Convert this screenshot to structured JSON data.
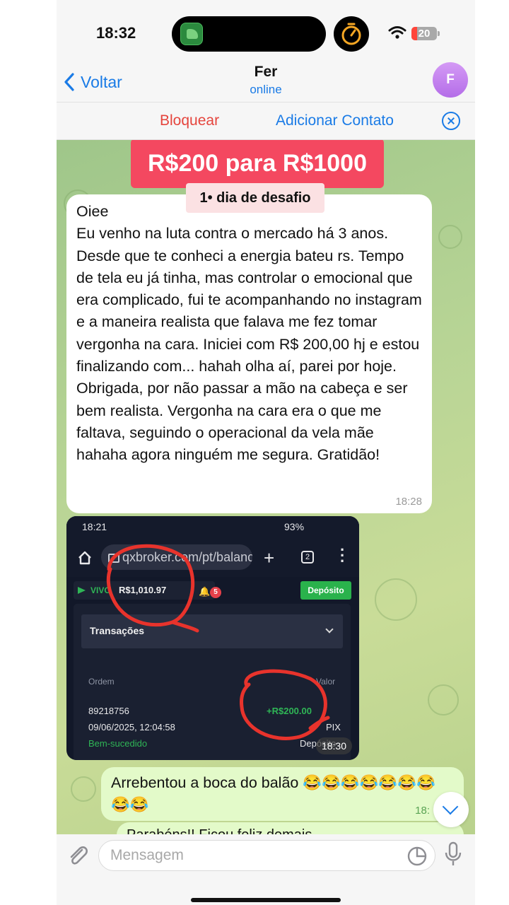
{
  "status_bar": {
    "time": "18:32",
    "battery": "20"
  },
  "header": {
    "back_label": "Voltar",
    "contact_name": "Fer",
    "contact_status": "online",
    "avatar_letter": "F"
  },
  "actions": {
    "block": "Bloquear",
    "add_contact": "Adicionar Contato"
  },
  "promo": {
    "title": "R$200 para R$1000",
    "subtitle": "1• dia de desafio"
  },
  "incoming_message": {
    "text": "Oiee\nEu venho na luta contra o mercado há 3 anos. Desde que te conheci a energia bateu rs. Tempo de tela eu já tinha, mas controlar o emocional que era complicado, fui te acompanhando no instagram e a maneira realista que falava me fez tomar vergonha na cara. Iniciei com R$ 200,00 hj e estou finalizando com... hahah olha aí, parei por hoje. Obrigada, por não passar a mão na cabeça e ser bem realista. Vergonha na cara era o que me faltava, seguindo o operacional da vela mãe hahaha agora ninguém me segura. Gratidão!",
    "time": "18:28"
  },
  "screenshot": {
    "status_time": "18:21",
    "status_right": "93%",
    "url": "qxbroker.com/pt/balanc",
    "tabs_count": "2",
    "live_label": "VIVO",
    "balance": "R$1,010.97",
    "notifications": "5",
    "deposit_button": "Depósito",
    "transactions_label": "Transações",
    "col_order": "Ordem",
    "col_value": "Valor",
    "order_id": "89218756",
    "datetime": "09/06/2025, 12:04:58",
    "state": "Bem-sucedido",
    "amount": "+R$200.00",
    "method": "PIX",
    "type": "Depósito",
    "time": "18:30"
  },
  "outgoing_message": {
    "text": "Arrebentou a boca do balão 😂😂😂😂😂😂😂😂😂",
    "time": "18:"
  },
  "outgoing_message_2": {
    "text": "Parabéns!! Ficou feliz demais"
  },
  "composer": {
    "placeholder": "Mensagem"
  }
}
